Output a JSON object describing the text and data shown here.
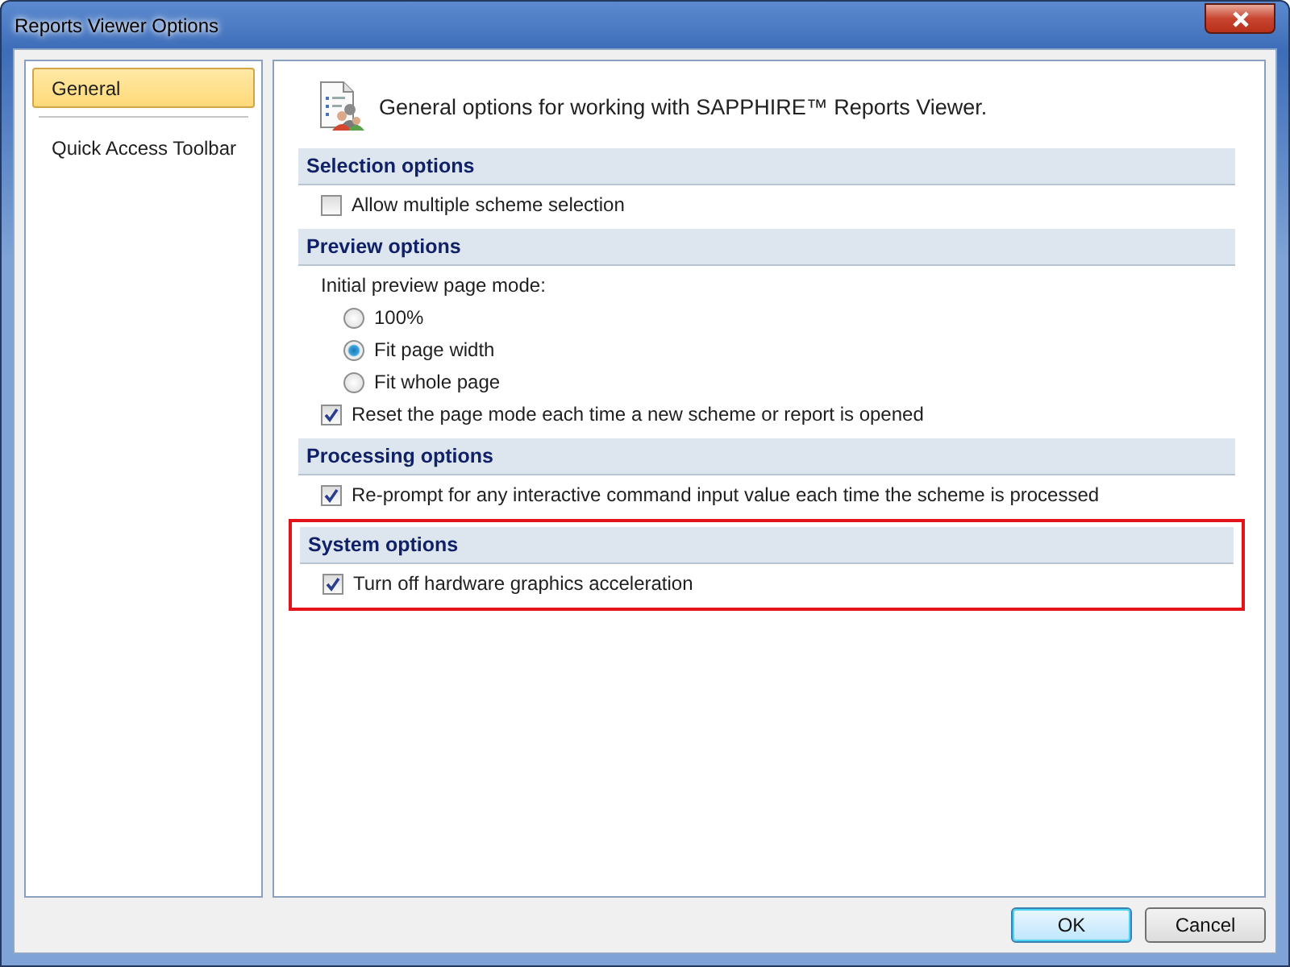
{
  "window": {
    "title": "Reports Viewer Options"
  },
  "sidebar": {
    "items": [
      {
        "label": "General",
        "selected": true
      },
      {
        "label": "Quick Access Toolbar",
        "selected": false
      }
    ]
  },
  "header": {
    "text": "General options for working with SAPPHIRE™ Reports Viewer."
  },
  "sections": [
    {
      "title": "Selection options",
      "highlighted": false,
      "items": [
        {
          "kind": "checkbox",
          "label": "Allow multiple scheme selection",
          "checked": false
        }
      ]
    },
    {
      "title": "Preview options",
      "highlighted": false,
      "items": [
        {
          "kind": "label",
          "label": "Initial preview page mode:"
        },
        {
          "kind": "radio",
          "label": "100%",
          "selected": false
        },
        {
          "kind": "radio",
          "label": "Fit page width",
          "selected": true
        },
        {
          "kind": "radio",
          "label": "Fit whole page",
          "selected": false
        },
        {
          "kind": "checkbox",
          "label": "Reset the page mode each time a new scheme or report is opened",
          "checked": true
        }
      ]
    },
    {
      "title": "Processing options",
      "highlighted": false,
      "items": [
        {
          "kind": "checkbox",
          "label": "Re-prompt for any interactive command input value each time the scheme is processed",
          "checked": true
        }
      ]
    },
    {
      "title": "System options",
      "highlighted": true,
      "items": [
        {
          "kind": "checkbox",
          "label": "Turn off hardware graphics acceleration",
          "checked": true
        }
      ]
    }
  ],
  "buttons": [
    {
      "label": "OK",
      "default": true
    },
    {
      "label": "Cancel",
      "default": false
    }
  ]
}
